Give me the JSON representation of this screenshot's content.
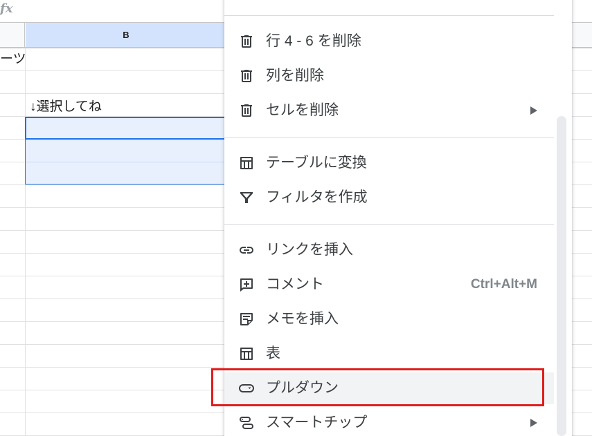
{
  "formula_bar": {
    "fx_label": "fx"
  },
  "columns": {
    "b_header": "B"
  },
  "cells": {
    "a2_text": "ーツ",
    "b4_text": "↓選択してね"
  },
  "menu": {
    "items": [
      {
        "label": "行 4 - 6 を削除",
        "icon": "trash-icon"
      },
      {
        "label": "列を削除",
        "icon": "trash-icon"
      },
      {
        "label": "セルを削除",
        "icon": "trash-icon",
        "submenu": true
      },
      {
        "label": "テーブルに変換",
        "icon": "table-icon"
      },
      {
        "label": "フィルタを作成",
        "icon": "filter-icon"
      },
      {
        "label": "リンクを挿入",
        "icon": "link-icon"
      },
      {
        "label": "コメント",
        "icon": "add-comment-icon",
        "shortcut": "Ctrl+Alt+M"
      },
      {
        "label": "メモを挿入",
        "icon": "note-icon"
      },
      {
        "label": "表",
        "icon": "table-icon"
      },
      {
        "label": "プルダウン",
        "icon": "dropdown-chip-icon"
      },
      {
        "label": "スマートチップ",
        "icon": "smart-chip-icon",
        "submenu": true
      }
    ]
  },
  "colors": {
    "highlight": "#e21c1c",
    "selection": "#1a73e8",
    "column_header_selected": "#d3e3fd"
  }
}
